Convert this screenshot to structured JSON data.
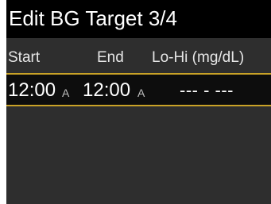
{
  "screen": {
    "title": "Edit BG Target 3/4",
    "columns": {
      "start": "Start",
      "end": "End",
      "range": "Lo-Hi (mg/dL)"
    },
    "rows": [
      {
        "start_time": "12:00",
        "start_ampm": "A",
        "end_time": "12:00",
        "end_ampm": "A",
        "range": "--- - ---"
      }
    ]
  },
  "colors": {
    "background": "#000000",
    "panel": "#2e2e2e",
    "selection_border": "#c9a227",
    "text": "#ffffff"
  }
}
